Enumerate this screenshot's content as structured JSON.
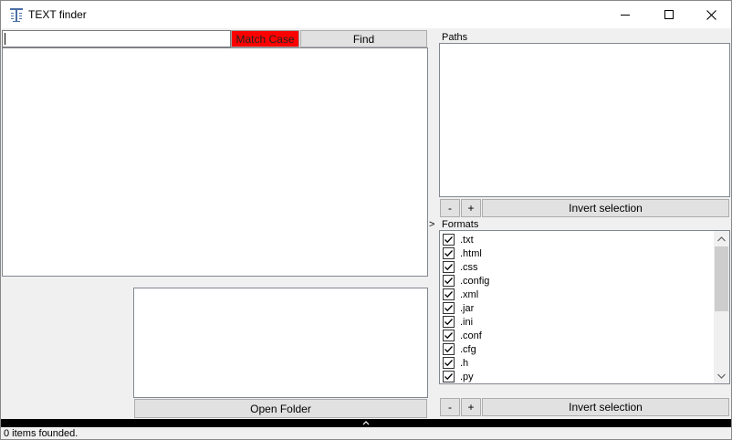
{
  "window": {
    "title": "TEXT finder"
  },
  "search": {
    "value": "",
    "match_case_label": "Match Case",
    "match_case_color": "#ff0000",
    "find_label": "Find"
  },
  "left_panel": {
    "open_folder_label": "Open Folder"
  },
  "splitter": {
    "arrow": ">"
  },
  "paths": {
    "label": "Paths",
    "remove_label": "-",
    "add_label": "+",
    "invert_label": "Invert selection"
  },
  "formats": {
    "label": "Formats",
    "items": [
      {
        "label": ".txt",
        "checked": true
      },
      {
        "label": ".html",
        "checked": true
      },
      {
        "label": ".css",
        "checked": true
      },
      {
        "label": ".config",
        "checked": true
      },
      {
        "label": ".xml",
        "checked": true
      },
      {
        "label": ".jar",
        "checked": true
      },
      {
        "label": ".ini",
        "checked": true
      },
      {
        "label": ".conf",
        "checked": true
      },
      {
        "label": ".cfg",
        "checked": true
      },
      {
        "label": ".h",
        "checked": true
      },
      {
        "label": ".py",
        "checked": true
      }
    ],
    "remove_label": "-",
    "add_label": "+",
    "invert_label": "Invert selection"
  },
  "status": {
    "text": "0 items founded."
  }
}
